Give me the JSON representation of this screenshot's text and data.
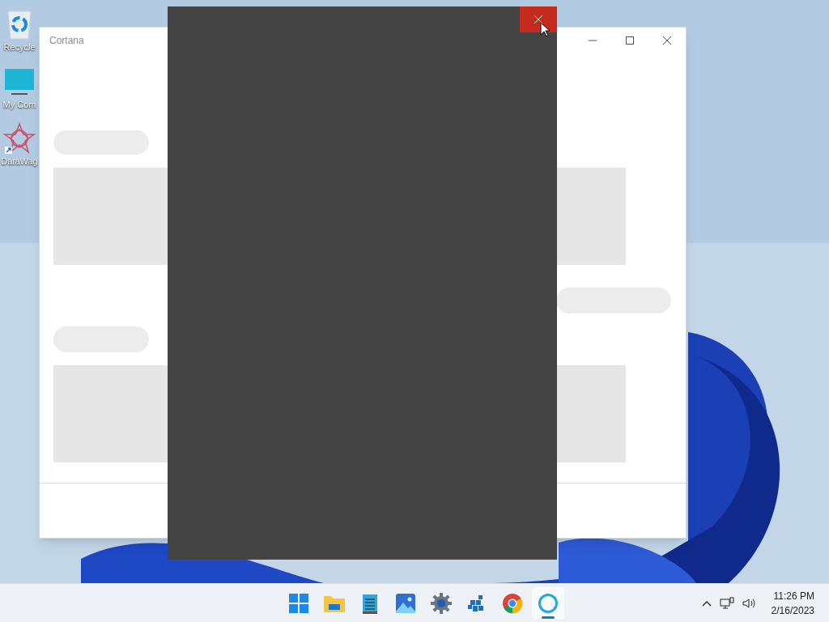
{
  "desktop_icons": [
    {
      "kind": "recycle",
      "label": "Recycle"
    },
    {
      "kind": "computer",
      "label": "My Com"
    },
    {
      "kind": "shortcut",
      "label": "DataWag"
    }
  ],
  "back_window": {
    "title": "Cortana"
  },
  "front_window": {
    "close_hovered": true
  },
  "taskbar": {
    "apps": [
      {
        "kind": "start",
        "active": false
      },
      {
        "kind": "folder",
        "active": false
      },
      {
        "kind": "notepad",
        "active": false
      },
      {
        "kind": "photos",
        "active": false
      },
      {
        "kind": "settings",
        "active": false
      },
      {
        "kind": "network-app",
        "active": false
      },
      {
        "kind": "browser",
        "active": false
      },
      {
        "kind": "cortana",
        "active": true
      }
    ],
    "time": "11:26 PM",
    "date": "2/16/2023"
  }
}
